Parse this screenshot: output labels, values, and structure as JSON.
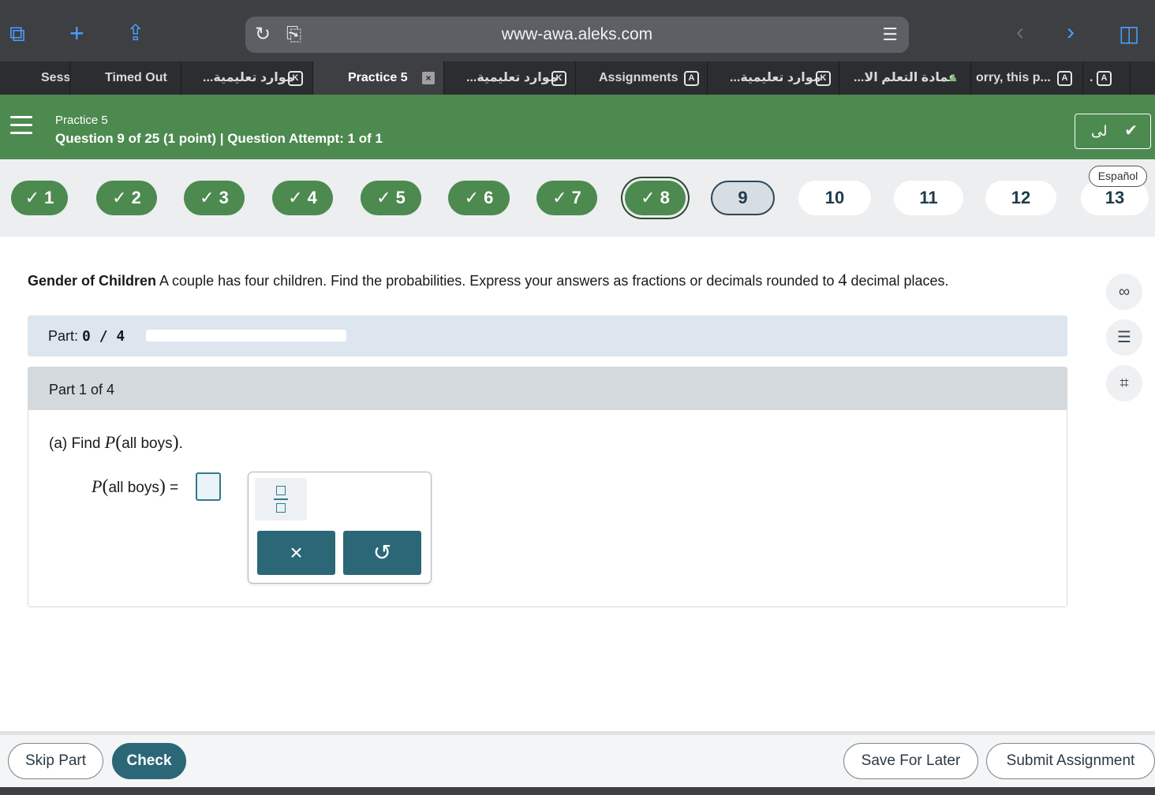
{
  "browser": {
    "url": "www-awa.aleks.com",
    "tabs": [
      {
        "label": "Sess",
        "badge": ""
      },
      {
        "label": "Timed Out",
        "badge": ""
      },
      {
        "label": "...موارد تعليمية",
        "badge": "K"
      },
      {
        "label": "Practice 5",
        "badge": "×"
      },
      {
        "label": "...موارد تعليمية",
        "badge": "K"
      },
      {
        "label": "Assignments",
        "badge": "A"
      },
      {
        "label": "...موارد تعليمية",
        "badge": "K"
      },
      {
        "label": "...عمادة التعلم الا",
        "badge": ""
      },
      {
        "label": "orry, this p...",
        "badge": "A"
      },
      {
        "label": ".",
        "badge": "A"
      }
    ]
  },
  "header": {
    "title": "Practice 5",
    "subtitle": "Question 9 of 25 (1 point)  |  Question Attempt: 1 of 1",
    "user_button": "لى"
  },
  "question_nav": {
    "language": "Español",
    "items": [
      {
        "label": "✓ 1",
        "state": "done"
      },
      {
        "label": "✓ 2",
        "state": "done"
      },
      {
        "label": "✓ 3",
        "state": "done"
      },
      {
        "label": "✓ 4",
        "state": "done"
      },
      {
        "label": "✓ 5",
        "state": "done"
      },
      {
        "label": "✓ 6",
        "state": "done"
      },
      {
        "label": "✓ 7",
        "state": "done"
      },
      {
        "label": "✓ 8",
        "state": "done-current"
      },
      {
        "label": "9",
        "state": "active"
      },
      {
        "label": "10",
        "state": "todo"
      },
      {
        "label": "11",
        "state": "todo"
      },
      {
        "label": "12",
        "state": "todo"
      },
      {
        "label": "13",
        "state": "todo"
      }
    ]
  },
  "problem": {
    "title": "Gender of Children",
    "text": " A couple has four children. Find the probabilities. Express your answers as fractions or decimals rounded to ",
    "digits": "4",
    "text_end": " decimal places."
  },
  "part": {
    "label": "Part: ",
    "progress": "0 / 4",
    "progress_fraction": 0,
    "box_title": "Part 1 of 4",
    "question_prefix": "(a)  Find ",
    "var": "P",
    "event": "all  boys",
    "question_suffix": ".",
    "answer_lhs_event": "all  boys",
    "equals": " ="
  },
  "toolbox": {
    "clear_label": "×",
    "undo_label": "↺"
  },
  "side_tools": [
    "glasses-icon",
    "notes-icon",
    "calculator-icon"
  ],
  "footer": {
    "skip": "Skip Part",
    "check": "Check",
    "save": "Save For Later",
    "submit": "Submit Assignment"
  }
}
